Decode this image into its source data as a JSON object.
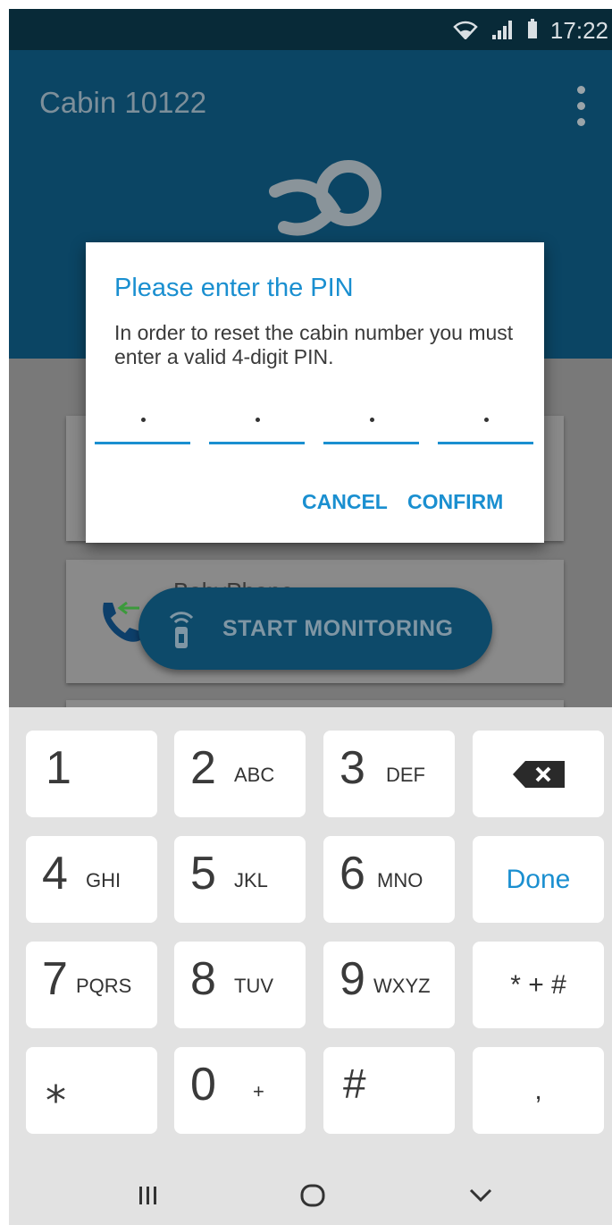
{
  "status_bar": {
    "time": "17:22",
    "icons": [
      "wifi-icon",
      "signal-icon",
      "battery-icon"
    ]
  },
  "app_bar": {
    "title": "Cabin 10122",
    "menu_icon": "more-vert-icon"
  },
  "content": {
    "card_title": "BabyPhone",
    "fab_label": "START MONITORING",
    "fab_icon": "wireless-device-icon"
  },
  "dialog": {
    "title": "Please enter the PIN",
    "message": "In order to reset the cabin number you must enter a valid 4-digit PIN.",
    "pin_placeholder": "·",
    "cancel_label": "CANCEL",
    "confirm_label": "CONFIRM"
  },
  "keyboard": {
    "rows": [
      [
        {
          "main": "1",
          "sub": ""
        },
        {
          "main": "2",
          "sub": "ABC"
        },
        {
          "main": "3",
          "sub": "DEF"
        },
        {
          "special": "backspace"
        }
      ],
      [
        {
          "main": "4",
          "sub": "GHI"
        },
        {
          "main": "5",
          "sub": "JKL"
        },
        {
          "main": "6",
          "sub": "MNO"
        },
        {
          "special": "Done"
        }
      ],
      [
        {
          "main": "7",
          "sub": "PQRS"
        },
        {
          "main": "8",
          "sub": "TUV"
        },
        {
          "main": "9",
          "sub": "WXYZ"
        },
        {
          "special": "* + #"
        }
      ],
      [
        {
          "main": "⁎",
          "sub": ""
        },
        {
          "main": "0",
          "sub": "+"
        },
        {
          "main": "#",
          "sub": ""
        },
        {
          "special": ","
        }
      ]
    ],
    "done_label": "Done",
    "symbols_label": "* + #",
    "comma_label": ","
  },
  "nav_bar": {
    "icons": [
      "recents-icon",
      "home-icon",
      "back-icon"
    ]
  },
  "colors": {
    "accent": "#1a8fd0",
    "app_bar": "#0b4564",
    "status_bar": "#082a38",
    "keyboard_bg": "#e2e2e2"
  }
}
